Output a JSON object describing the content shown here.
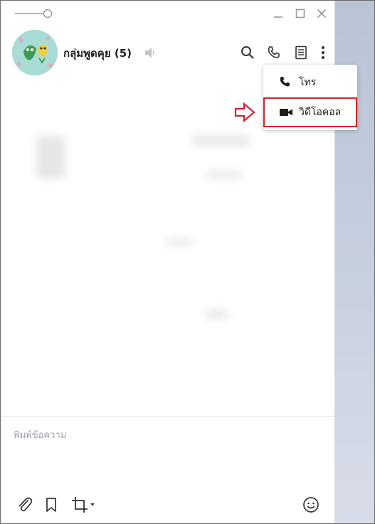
{
  "window": {
    "controls": {
      "minimize_icon": "minimize-icon",
      "maximize_icon": "maximize-icon",
      "close_icon": "close-icon"
    }
  },
  "header": {
    "title": "กลุ่มพูดคุย (5)",
    "icons": [
      "search-icon",
      "phone-icon",
      "notes-icon",
      "more-vertical-icon"
    ]
  },
  "call_menu": {
    "items": [
      {
        "label": "โทร",
        "icon": "phone-icon"
      },
      {
        "label": "วิดีโอคอล",
        "icon": "video-camera-icon"
      }
    ],
    "highlight_color": "#d2232a"
  },
  "composer": {
    "placeholder": "พิมพ์ข้อความ",
    "tools": [
      "paperclip-icon",
      "bookmark-icon",
      "crop-icon",
      "emoji-icon"
    ]
  },
  "colors": {
    "accent": "#d2232a",
    "background_panel": "#c5cde0"
  }
}
